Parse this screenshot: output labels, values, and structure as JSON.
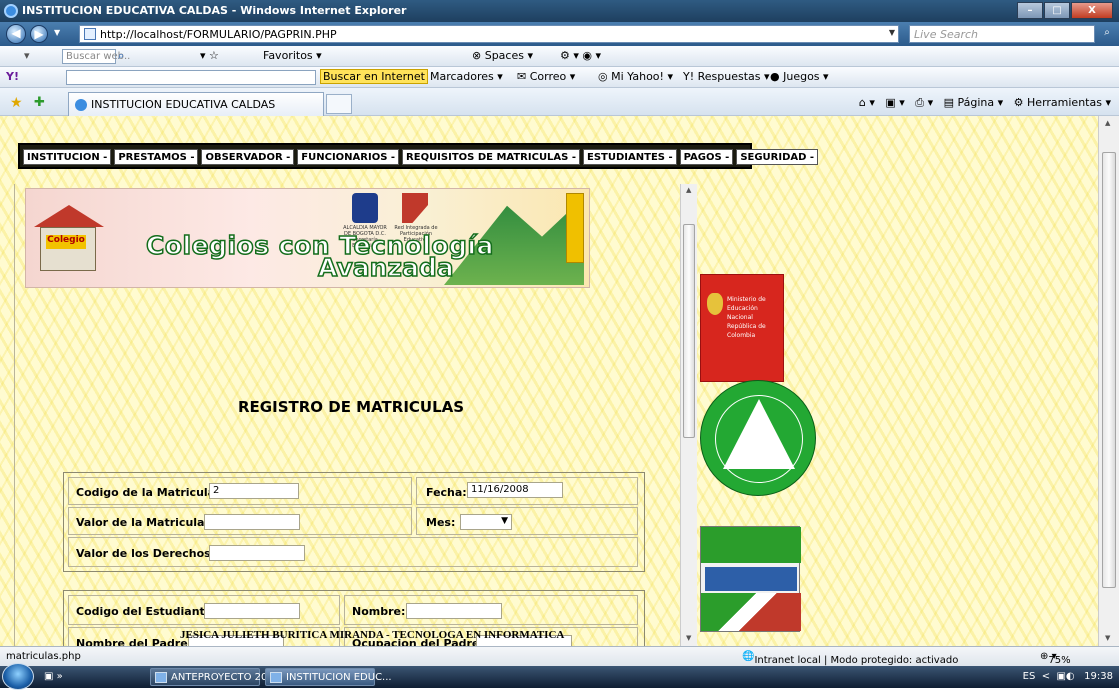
{
  "window": {
    "title": "INSTITUCION EDUCATIVA CALDAS - Windows Internet Explorer",
    "min": "–",
    "max": "□",
    "close": "X"
  },
  "address": {
    "url": "http://localhost/FORMULARIO/PAGPRIN.PHP",
    "search_placeholder": "Live Search"
  },
  "toolbar1": {
    "search_placeholder": "Buscar web..",
    "favoritos": "Favoritos",
    "spaces": "Spaces"
  },
  "toolbar2": {
    "buscar": "Buscar en Internet",
    "marcadores": "Marcadores",
    "correo": "Correo",
    "mi_yahoo": "Mi Yahoo!",
    "respuestas": "Y! Respuestas",
    "juegos": "Juegos"
  },
  "tabs": {
    "active": "INSTITUCION EDUCATIVA CALDAS",
    "pagina": "Página",
    "herramientas": "Herramientas"
  },
  "menu": [
    "INSTITUCION -",
    "PRESTAMOS -",
    "OBSERVADOR -",
    "FUNCIONARIOS -",
    "REQUISITOS DE MATRICULAS -",
    "ESTUDIANTES -",
    "PAGOS -",
    "SEGURIDAD -"
  ],
  "banner": {
    "line1": "Colegios con Tecnología",
    "line2": "Avanzada",
    "sign": "Colegio",
    "alcaldia": "ALCALDIA MAYOR DE BOGOTA D.C. Secretaría Educación",
    "red": "Red Integrada de Participación Educativa"
  },
  "form": {
    "heading": "REGISTRO DE MATRICULAS",
    "codigo_matricula": {
      "label": "Codigo de la Matricula:",
      "value": "2"
    },
    "fecha": {
      "label": "Fecha:",
      "value": "11/16/2008"
    },
    "valor_matricula": {
      "label": "Valor de la Matricula:",
      "value": ""
    },
    "mes": {
      "label": "Mes:",
      "value": ""
    },
    "valor_derechos": {
      "label": "Valor de los Derechos:",
      "value": ""
    },
    "codigo_estudiante": {
      "label": "Codigo del Estudiante:",
      "value": ""
    },
    "nombre": {
      "label": "Nombre:",
      "value": ""
    },
    "nombre_padre": {
      "label": "Nombre del Padre:",
      "value": ""
    },
    "ocupacion_padre": {
      "label": "Ocupacion del Padre:",
      "value": ""
    }
  },
  "footer": "JESICA JULIETH BURITICA MIRANDA - TECNOLOGA EN INFORMATICA",
  "sidelogos": {
    "mineduc": "Ministerio de Educación Nacional República de Colombia"
  },
  "status": {
    "link": "matriculas.php",
    "zone": "Intranet local | Modo protegido: activado",
    "zoom": "75%"
  },
  "taskbar": {
    "item1": "ANTEPROYECTO 20...",
    "item2": "INSTITUCION EDUC...",
    "lang": "ES",
    "time": "19:38"
  }
}
